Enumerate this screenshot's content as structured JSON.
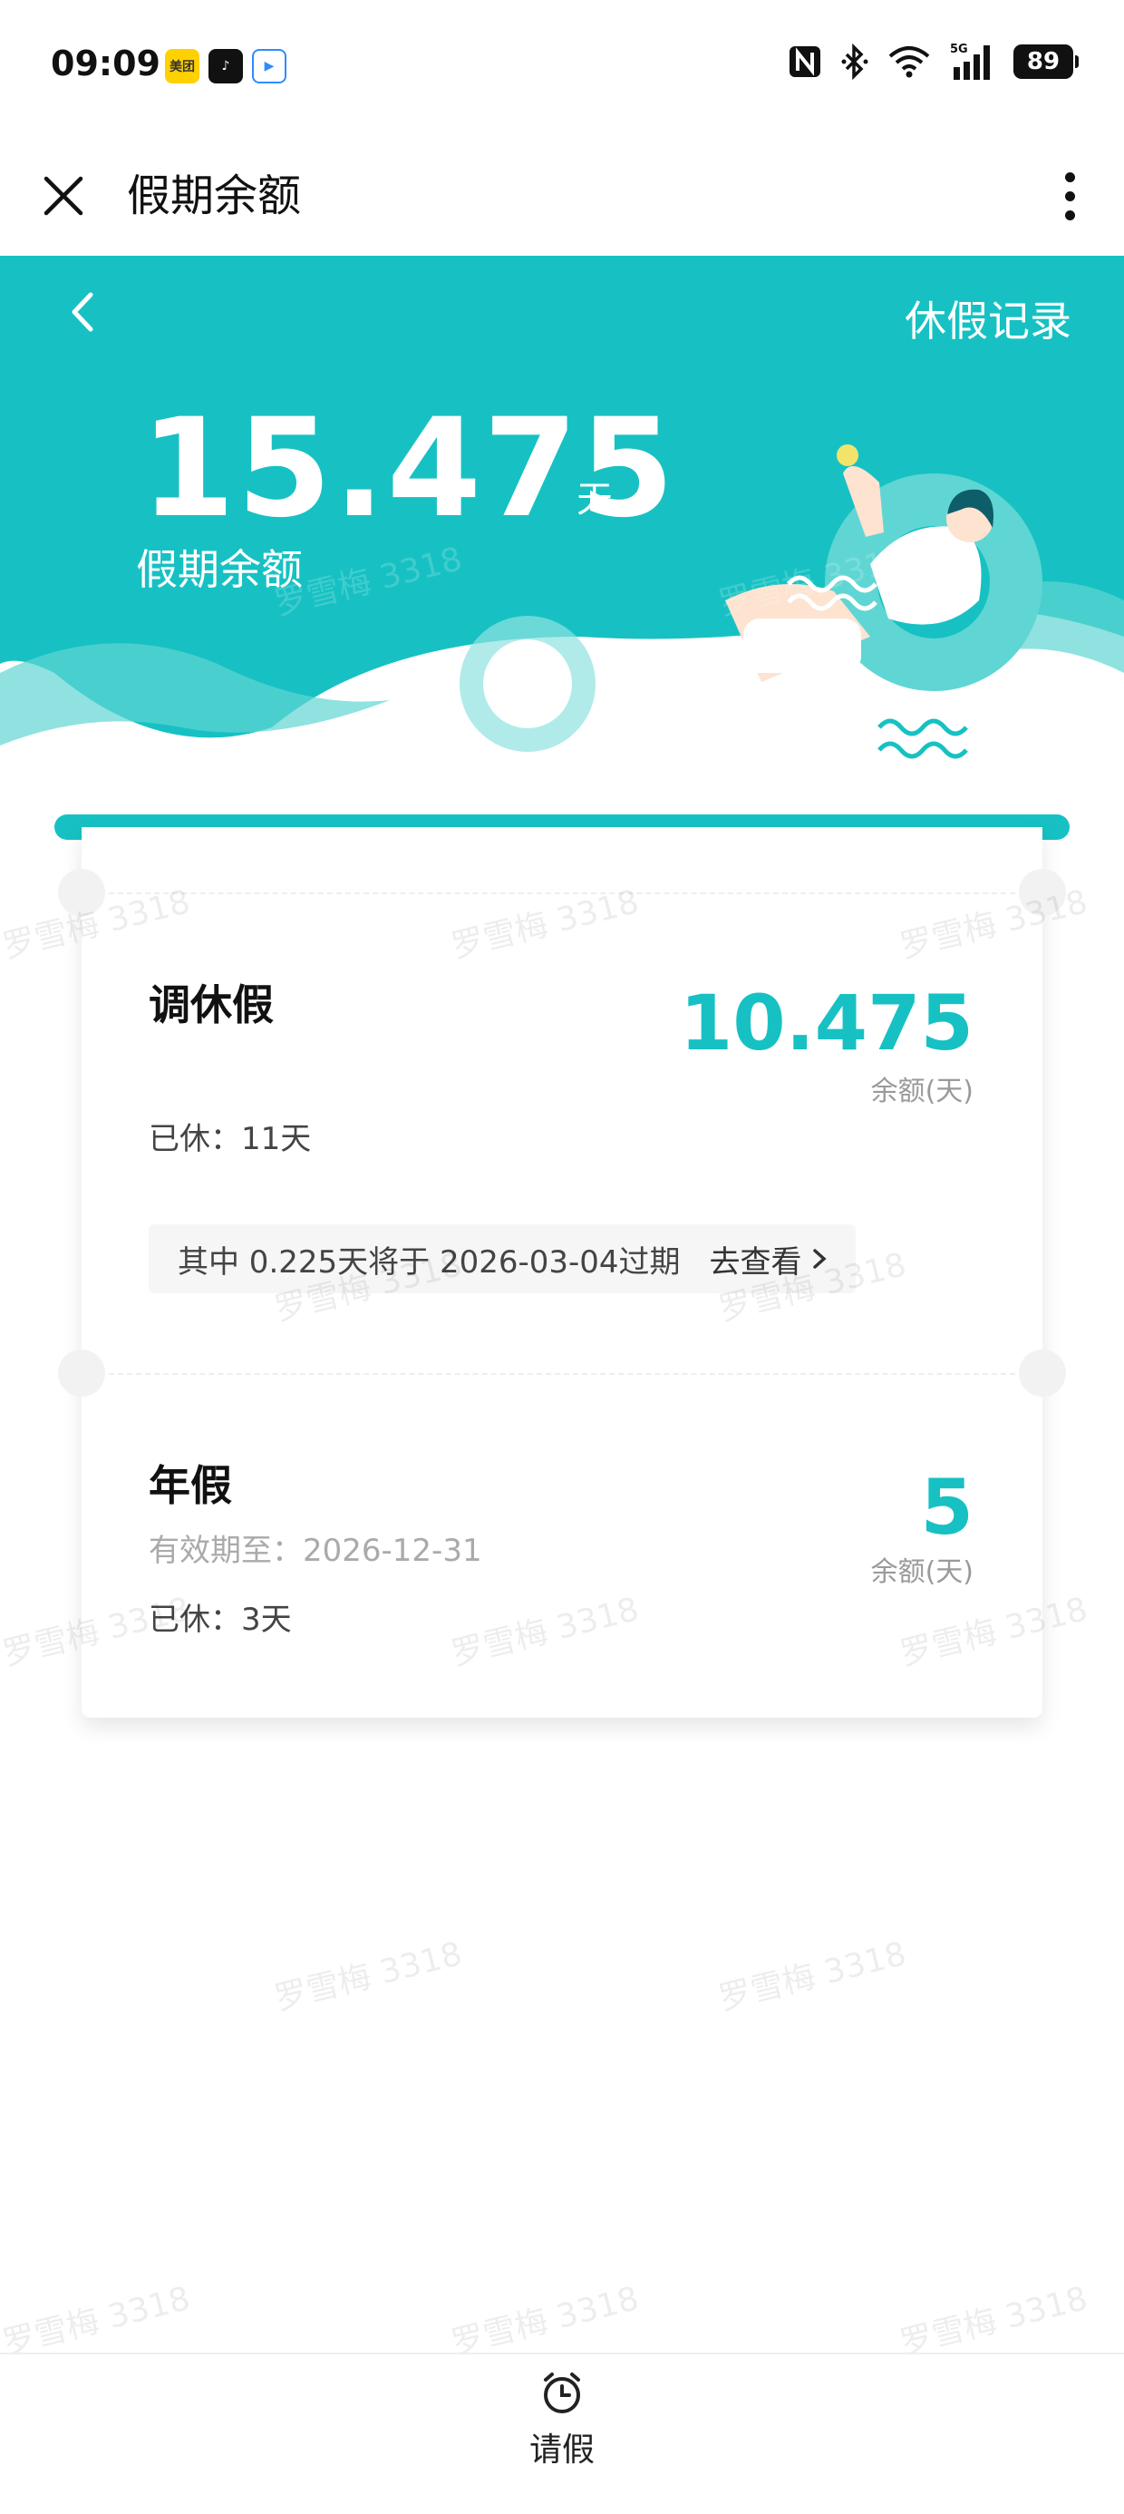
{
  "status_bar": {
    "time": "09:09",
    "apps": [
      {
        "name": "meituan-app-icon",
        "glyph": "美团"
      },
      {
        "name": "douyin-app-icon",
        "glyph": "♪"
      },
      {
        "name": "video-app-icon",
        "glyph": "▶"
      }
    ],
    "battery": "89",
    "network": "5G"
  },
  "header": {
    "title": "假期余额",
    "close_icon": "close-icon",
    "more_icon": "more-vertical-icon"
  },
  "banner": {
    "back_icon": "chevron-left-icon",
    "records_link": "休假记录",
    "balance_value": "15.475",
    "balance_unit": "天",
    "balance_label": "假期余额",
    "colors": {
      "primary": "#17c1c3",
      "light": "#5fd6d3"
    }
  },
  "cards": [
    {
      "title": "调休假",
      "amount": "10.475",
      "amount_label": "余额(天)",
      "used": "已休：11天",
      "expire_note": "其中 0.225天将于 2026-03-04过期",
      "expire_link": "去查看"
    },
    {
      "title": "年假",
      "amount": "5",
      "amount_label": "余额(天)",
      "valid_until": "有效期至：2026-12-31",
      "used": "已休：3天"
    }
  ],
  "bottom_bar": {
    "leave_label": "请假",
    "leave_icon": "alarm-clock-icon"
  },
  "watermark_text": "罗雪梅 3318"
}
